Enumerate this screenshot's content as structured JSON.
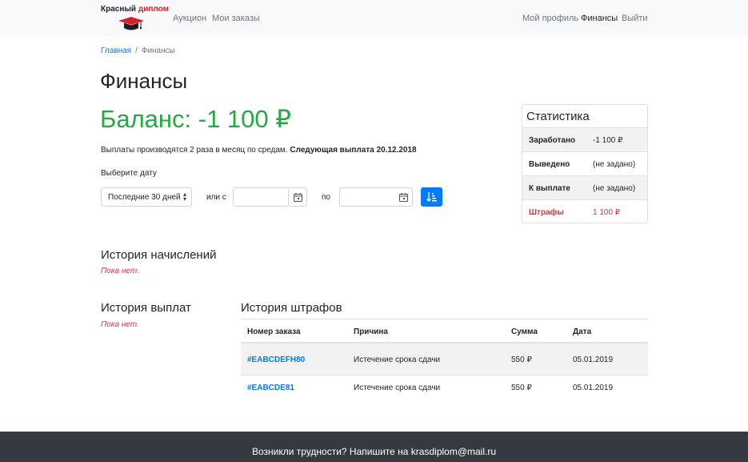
{
  "navbar": {
    "brand_part1": "Красный",
    "brand_part2": "диплом",
    "left_links": [
      "Аукцион",
      "Мои заказы"
    ],
    "right_links": [
      "Мой профиль",
      "Финансы",
      "Выйти"
    ],
    "active": "Финансы"
  },
  "breadcrumb": {
    "home": "Главная",
    "separator": "/",
    "current": "Финансы"
  },
  "page_title": "Финансы",
  "balance": "Баланс: -1 100 ₽",
  "payout_info": {
    "text": "Выплаты производятся 2 раза в месяц по средам.",
    "next": "Следующая выплата 20.12.2018"
  },
  "filter": {
    "label": "Выберите дату",
    "period_value": "Последние 30 дней",
    "or_from": "или с",
    "to": "по",
    "from_value": "",
    "to_value": ""
  },
  "stats": {
    "title": "Статистика",
    "rows": [
      {
        "label": "Заработано",
        "value": "-1 100 ₽"
      },
      {
        "label": "Выведено",
        "value": "(не задано)"
      },
      {
        "label": "К выплате",
        "value": "(не задано)"
      },
      {
        "label": "Штрафы",
        "value": "1 100 ₽"
      }
    ]
  },
  "accruals": {
    "title": "История начислений",
    "empty": "Пока нет."
  },
  "payouts": {
    "title": "История выплат",
    "empty": "Пока нет."
  },
  "penalties": {
    "title": "История штрафов",
    "columns": [
      "Номер заказа",
      "Причина",
      "Сумма",
      "Дата"
    ],
    "rows": [
      {
        "order": "#EABCDEFH80",
        "reason": "Истечение срока сдачи",
        "amount": "550 ₽",
        "date": "05.01.2019"
      },
      {
        "order": "#EABCDE81",
        "reason": "Истечение срока сдачи",
        "amount": "550 ₽",
        "date": "05.01.2019"
      }
    ]
  },
  "footer": {
    "text": "Возникли трудности? Напишите на krasdiplom@mail.ru"
  },
  "colors": {
    "success": "#28a745",
    "danger": "#dc3545",
    "primary": "#007bff",
    "footer_bg": "#343a40"
  },
  "icons": {
    "date_picker": "calendar-icon",
    "sort": "sort-ascending-icon",
    "brand": "graduation-cap-icon"
  }
}
